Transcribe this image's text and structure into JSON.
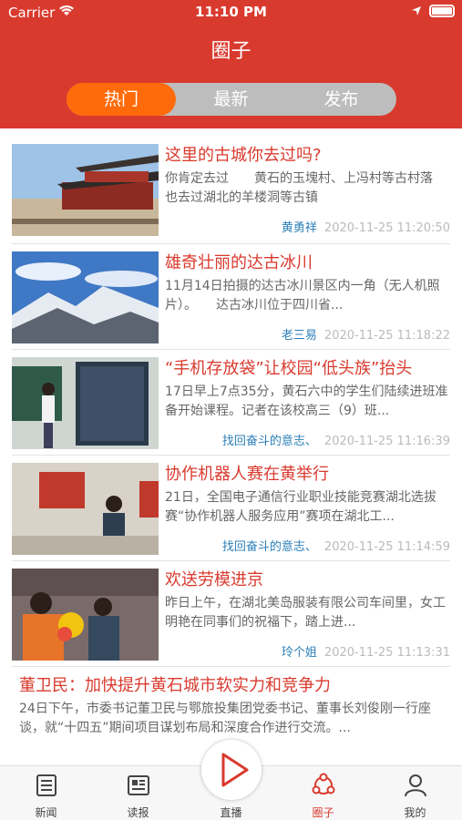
{
  "status": {
    "carrier": "Carrier",
    "time": "11:10 PM"
  },
  "header": {
    "title": "圈子"
  },
  "segments": [
    {
      "label": "热门",
      "active": true
    },
    {
      "label": "最新",
      "active": false
    },
    {
      "label": "发布",
      "active": false
    }
  ],
  "items": [
    {
      "title": "这里的古城你去过吗?",
      "desc": "你肯定去过　　黄石的玉塊村、上冯村等古村落　　也去过湖北的羊楼洞等古镇",
      "author": "黄勇祥",
      "date": "2020-11-25 11:20:50"
    },
    {
      "title": "雄奇壮丽的达古冰川",
      "desc": "11月14日拍摄的达古冰川景区内一角（无人机照片）。　　达古冰川位于四川省...",
      "author": "老三易",
      "date": "2020-11-25 11:18:22"
    },
    {
      "title": "“手机存放袋”让校园“低头族”抬头",
      "desc": "17日早上7点35分，黄石六中的学生们陆续进班准备开始课程。记者在该校高三（9）班...",
      "author": "找回奋斗的意志、",
      "date": "2020-11-25 11:16:39"
    },
    {
      "title": "协作机器人赛在黄举行",
      "desc": "21日，全国电子通信行业职业技能竞赛湖北选拔赛“协作机器人服务应用”赛项在湖北工...",
      "author": "找回奋斗的意志、",
      "date": "2020-11-25 11:14:59"
    },
    {
      "title": "欢送劳模进京",
      "desc": "昨日上午，在湖北美岛服装有限公司车间里，女工明艳在同事们的祝福下，踏上进...",
      "author": "玲个姐",
      "date": "2020-11-25 11:13:31"
    }
  ],
  "wide_item": {
    "title": "董卫民：加快提升黄石城市软实力和竞争力",
    "desc": "24日下午，市委书记董卫民与鄂旅投集团党委书记、董事长刘俊刚一行座谈，就“十四五”期间项目谋划布局和深度合作进行交流。..."
  },
  "tabbar": [
    {
      "label": "新闻",
      "icon": "news-icon"
    },
    {
      "label": "读报",
      "icon": "newspaper-icon"
    },
    {
      "label": "直播",
      "icon": "play-icon"
    },
    {
      "label": "圈子",
      "icon": "circle-icon",
      "active": true
    },
    {
      "label": "我的",
      "icon": "user-icon"
    }
  ],
  "colors": {
    "brand": "#d93a2e",
    "segment_active": "#ff6a0a",
    "author": "#2c7fb8"
  }
}
